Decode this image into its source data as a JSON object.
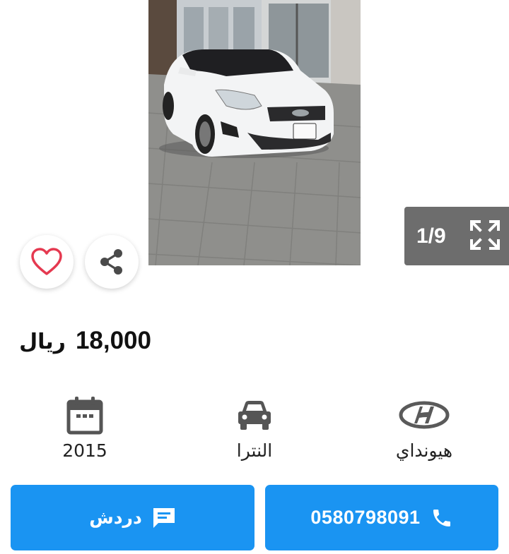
{
  "gallery": {
    "counter": "1/9",
    "accent_color": "#6d6d6d"
  },
  "listing": {
    "price": "18,000",
    "currency": "ريال"
  },
  "specs": {
    "year": "2015",
    "model": "النترا",
    "brand": "هيونداي"
  },
  "actions": {
    "chat_label": "دردش",
    "phone": "0580798091",
    "button_color": "#1a94f2"
  },
  "icons": {
    "prev": "chevron-left-icon",
    "next": "chevron-right-icon",
    "fullscreen": "expand-icon",
    "favorite": "heart-icon",
    "share": "share-icon",
    "year": "calendar-icon",
    "model": "car-icon",
    "brand": "hyundai-logo-icon",
    "chat": "chat-icon",
    "call": "phone-icon"
  }
}
